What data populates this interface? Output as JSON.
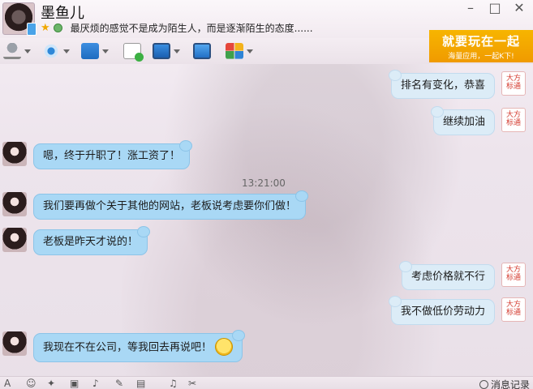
{
  "contact": {
    "name": "墨鱼儿",
    "signature": "最厌烦的感觉不是成为陌生人，而是逐渐陌生的态度......"
  },
  "window_controls": {
    "minimize": "–",
    "maximize": "□",
    "close": "✕"
  },
  "banner": {
    "title": "就要玩在一起",
    "subtitle": "海量应用，一起K下!"
  },
  "my_avatar_text": "大方\n标通",
  "messages": [
    {
      "side": "right",
      "text": "排名有变化，恭喜"
    },
    {
      "side": "right",
      "text": "继续加油"
    },
    {
      "side": "left",
      "text": "嗯，终于升职了！涨工资了！"
    },
    {
      "side": "left",
      "text": "我们要再做个关于其他的网站，老板说考虑要你们做！"
    },
    {
      "side": "left",
      "text": "老板是昨天才说的！"
    },
    {
      "side": "right",
      "text": "考虑价格就不行"
    },
    {
      "side": "right",
      "text": "我不做低价劳动力"
    },
    {
      "side": "left",
      "text": "我现在不在公司，等我回去再说吧！"
    }
  ],
  "timestamp": "13:21:00",
  "bottombar": {
    "history_label": "消息记录"
  },
  "colors": {
    "peer_bubble": "#a9d8f5",
    "my_bubble": "#dcecf7",
    "banner": "#f7b500"
  }
}
